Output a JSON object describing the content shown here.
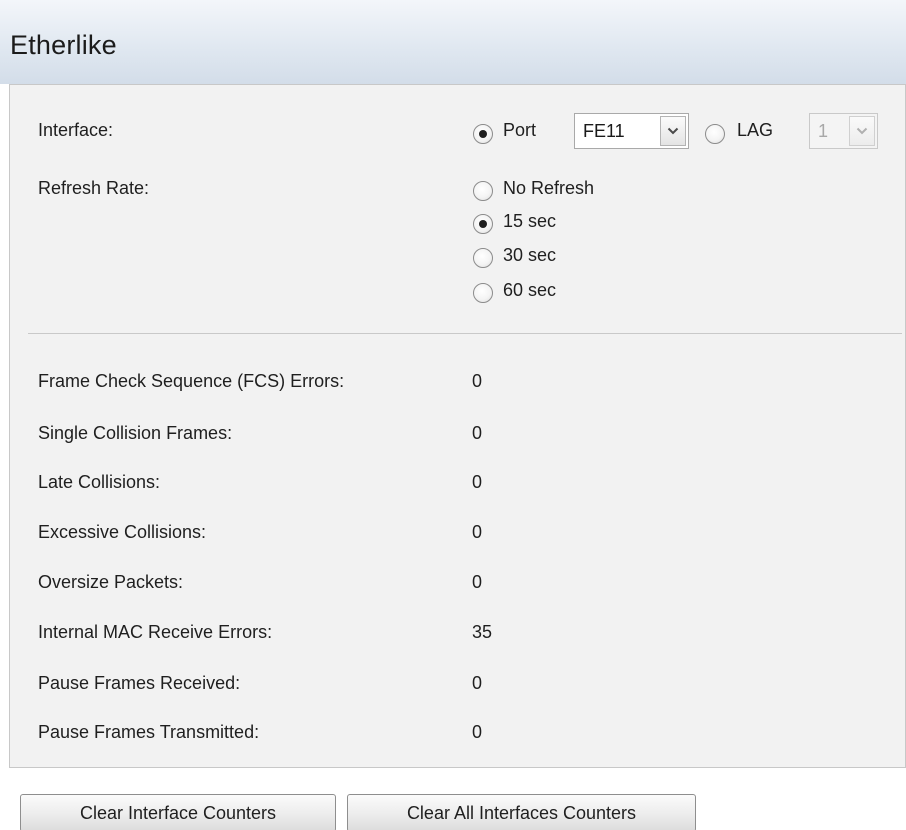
{
  "page_title": "Etherlike",
  "interface": {
    "label": "Interface:",
    "port_label": "Port",
    "port_value": "FE11",
    "lag_label": "LAG",
    "lag_value": "1",
    "selected": "Port"
  },
  "refresh_rate": {
    "label": "Refresh Rate:",
    "options": [
      "No Refresh",
      "15 sec",
      "30 sec",
      "60 sec"
    ],
    "selected": "15 sec"
  },
  "stats": [
    {
      "label": "Frame Check Sequence (FCS) Errors:",
      "value": "0"
    },
    {
      "label": "Single Collision Frames:",
      "value": "0"
    },
    {
      "label": "Late Collisions:",
      "value": "0"
    },
    {
      "label": "Excessive Collisions:",
      "value": "0"
    },
    {
      "label": "Oversize Packets:",
      "value": "0"
    },
    {
      "label": "Internal MAC Receive Errors:",
      "value": "35"
    },
    {
      "label": "Pause Frames Received:",
      "value": "0"
    },
    {
      "label": "Pause Frames Transmitted:",
      "value": "0"
    }
  ],
  "buttons": {
    "clear_interface": "Clear Interface Counters",
    "clear_all": "Clear All Interfaces Counters"
  },
  "colors": {
    "header_gradient_top": "#f3f6fa",
    "header_gradient_bottom": "#d3dde9",
    "panel_background": "#f2f2f2"
  }
}
